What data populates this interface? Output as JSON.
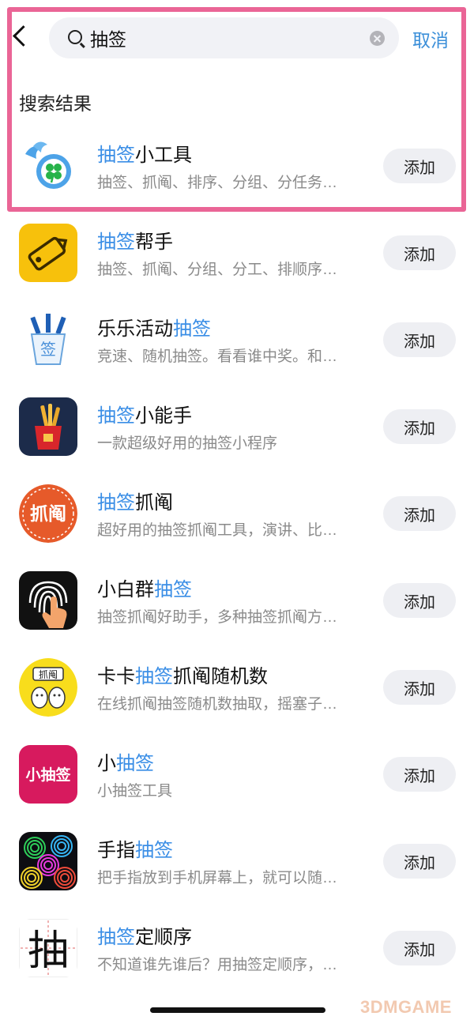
{
  "search": {
    "value": "抽签",
    "cancel_label": "取消"
  },
  "section_title": "搜索结果",
  "add_label": "添加",
  "accent_color": "#3a8ee6",
  "highlight_color": "#ea6596",
  "results": [
    {
      "title_pre": "",
      "title_hl": "抽签",
      "title_post": "小工具",
      "desc": "抽签、抓阄、排序、分组、分任务…",
      "icon": "clover-lottery-icon"
    },
    {
      "title_pre": "",
      "title_hl": "抽签",
      "title_post": "帮手",
      "desc": "抽签、抓阄、分组、分工、排顺序…",
      "icon": "tag-icon"
    },
    {
      "title_pre": "乐乐活动",
      "title_hl": "抽签",
      "title_post": "",
      "desc": "竞速、随机抽签。看看谁中奖。和…",
      "icon": "lottery-cup-icon"
    },
    {
      "title_pre": "",
      "title_hl": "抽签",
      "title_post": "小能手",
      "desc": "一款超级好用的抽签小程序",
      "icon": "lottery-box-icon"
    },
    {
      "title_pre": "",
      "title_hl": "抽签",
      "title_post": "抓阄",
      "desc": "超好用的抽签抓阄工具，演讲、比…",
      "icon": "zhuajiu-badge-icon",
      "icon_text": "抓阄"
    },
    {
      "title_pre": "小白群",
      "title_hl": "抽签",
      "title_post": "",
      "desc": "抽签抓阄好助手，多种抽签抓阄方…",
      "icon": "fingerprint-icon"
    },
    {
      "title_pre": "卡卡",
      "title_hl": "抽签",
      "title_post": "抓阄随机数",
      "desc": "在线抓阄抽签随机数抽取，摇塞子…",
      "icon": "cartoon-sticker-icon",
      "icon_text": "抓阄"
    },
    {
      "title_pre": "小",
      "title_hl": "抽签",
      "title_post": "",
      "desc": "小抽签工具",
      "icon": "xiaochouqian-logo-icon",
      "icon_text": "小抽签"
    },
    {
      "title_pre": "手指",
      "title_hl": "抽签",
      "title_post": "",
      "desc": "把手指放到手机屏幕上，就可以随…",
      "icon": "colorful-fingerprints-icon"
    },
    {
      "title_pre": "",
      "title_hl": "抽签",
      "title_post": "定顺序",
      "desc": "不知道谁先谁后？用抽签定顺序，…",
      "icon": "chou-character-icon",
      "icon_text": "抽"
    }
  ],
  "watermark": "3DMGAME"
}
